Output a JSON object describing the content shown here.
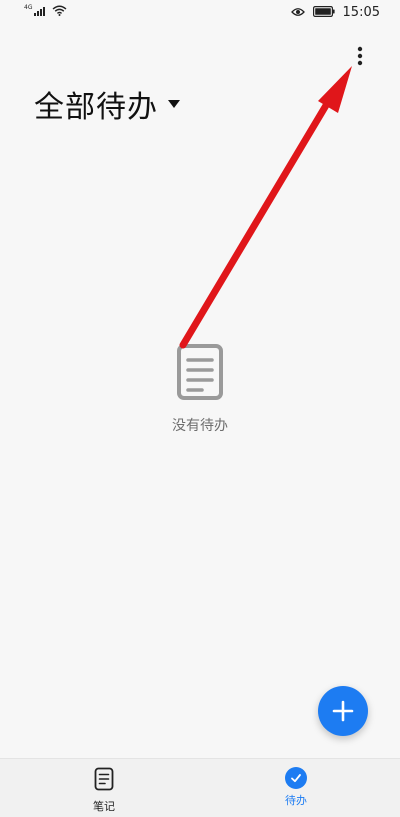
{
  "status_bar": {
    "network_type": "4G",
    "time": "15:05",
    "icons": [
      "signal-icon",
      "wifi-icon",
      "eye-icon",
      "battery-icon"
    ]
  },
  "header": {
    "title": "全部待办",
    "more_icon": "more-vertical-icon",
    "dropdown_icon": "caret-down-icon"
  },
  "empty_state": {
    "icon": "document-icon",
    "text": "没有待办"
  },
  "fab": {
    "icon": "plus-icon"
  },
  "bottom_nav": {
    "tabs": [
      {
        "label": "笔记",
        "icon": "note-icon",
        "active": false
      },
      {
        "label": "待办",
        "icon": "checklist-icon",
        "active": true
      }
    ]
  },
  "colors": {
    "accent": "#1d7cf2",
    "background": "#f7f7f7",
    "annotation_arrow": "#e0161a"
  }
}
